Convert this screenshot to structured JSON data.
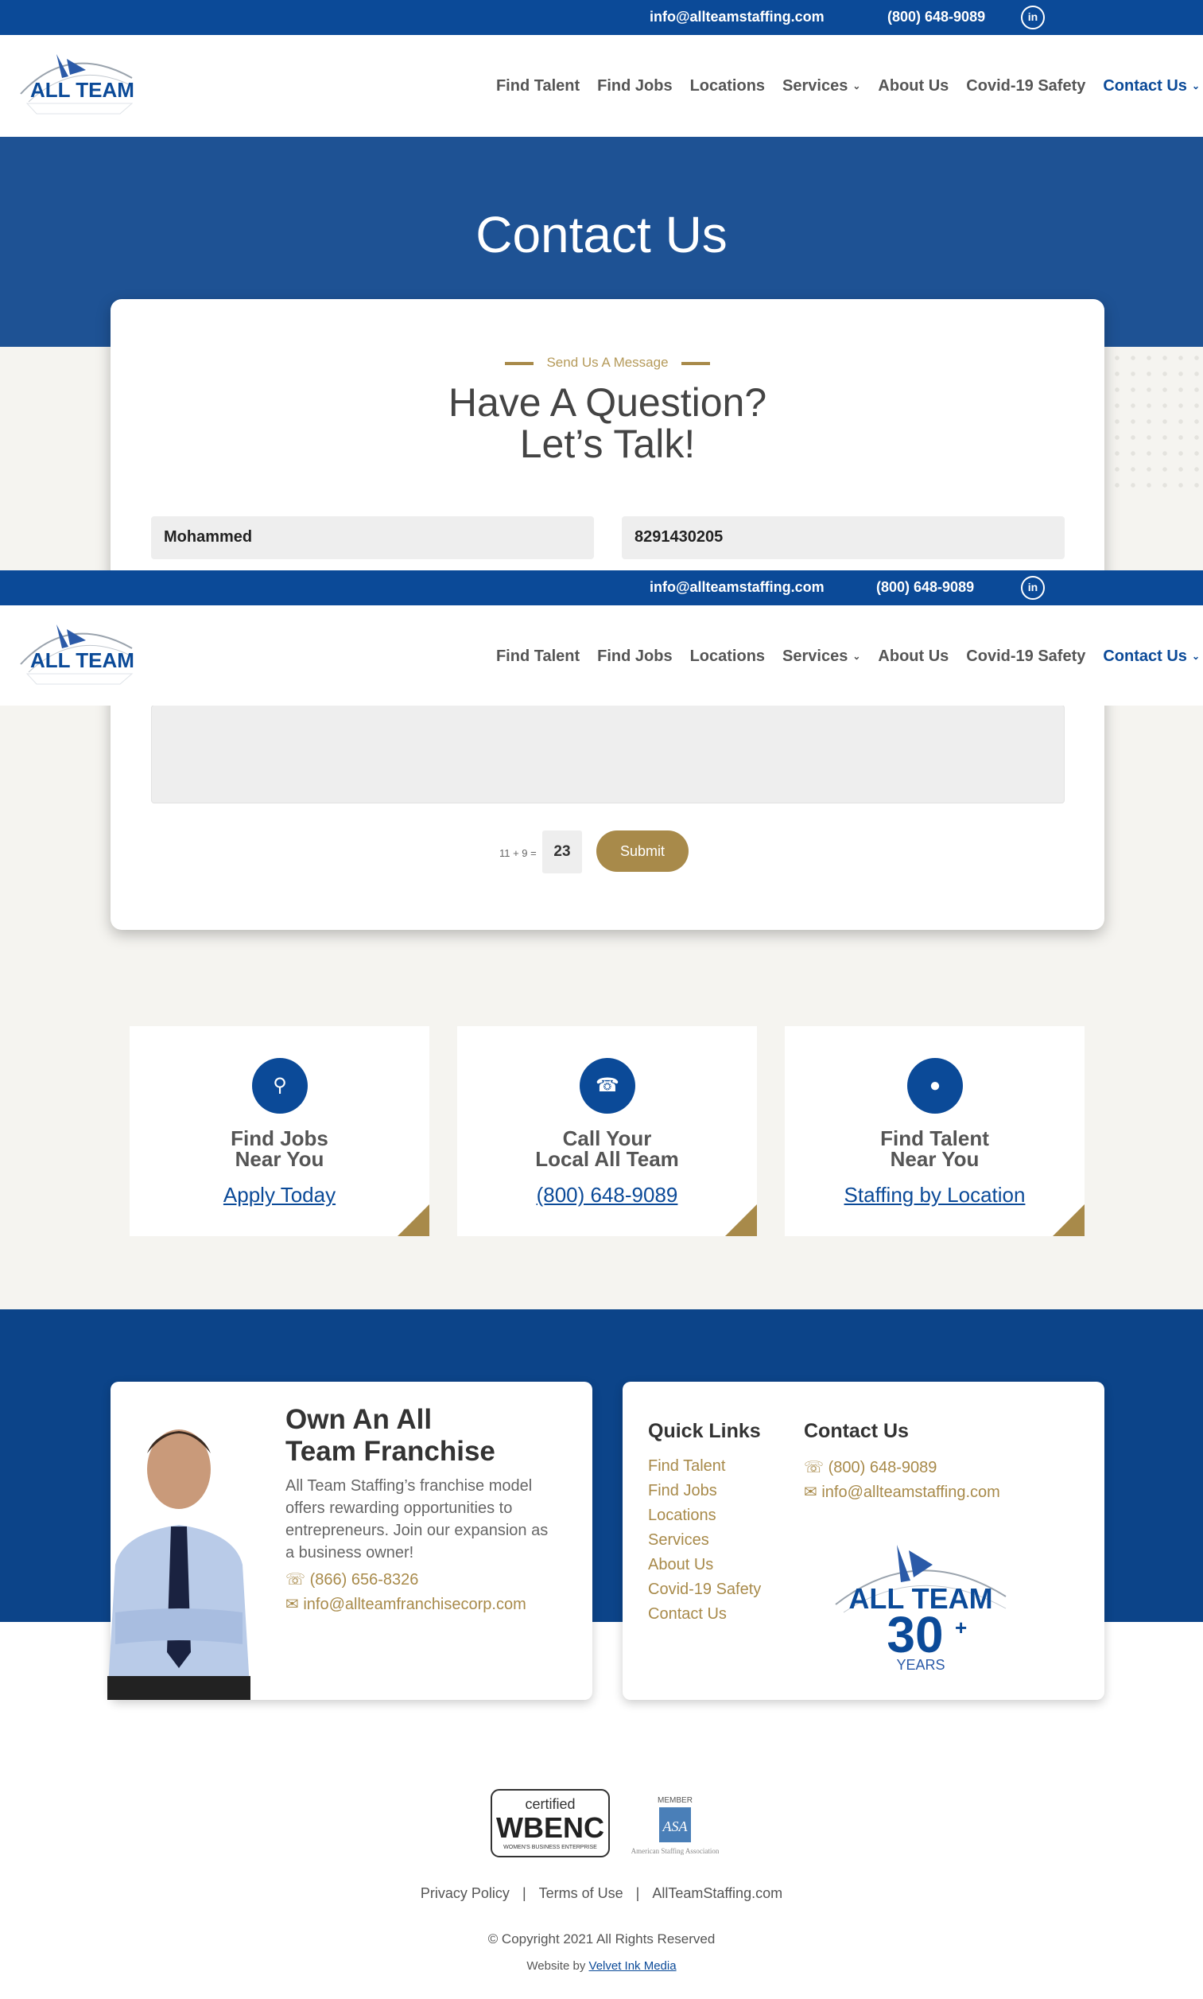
{
  "topbar": {
    "email": "info@allteamstaffing.com",
    "phone": "(800) 648-9089",
    "linkedin": "in"
  },
  "topbar2": {
    "phone": "(800) 648-9089"
  },
  "nav": {
    "items": [
      "Find Talent",
      "Find Jobs",
      "Locations",
      "Services",
      "About Us",
      "Covid-19 Safety",
      "Contact Us"
    ]
  },
  "logo": {
    "text": "ALL TEAM"
  },
  "hero": {
    "title": "Contact Us"
  },
  "form": {
    "eyebrow": "Send Us A Message",
    "heading_line1": "Have A Question?",
    "heading_line2": "Let’s Talk!",
    "name_value": "Mohammed",
    "phone_value": "8291430205",
    "captcha_label": "11 + 9 =",
    "captcha_value": "23",
    "submit_label": "Submit"
  },
  "cards": [
    {
      "title1": "Find Jobs",
      "title2": "Near You",
      "link": "Apply Today",
      "icon": "search-icon"
    },
    {
      "title1": "Call Your",
      "title2": "Local All Team",
      "link": "(800) 648-9089",
      "icon": "phone-icon"
    },
    {
      "title1": "Find Talent",
      "title2": "Near You",
      "link": "Staffing by Location",
      "icon": "person-icon"
    }
  ],
  "franchise": {
    "title1": "Own An All",
    "title2": "Team Franchise",
    "body": "All Team Staffing’s franchise model offers rewarding opportunities to entrepreneurs. Join our expansion as a business owner!",
    "phone": "(866) 656-8326",
    "email": "info@allteamfranchisecorp.com"
  },
  "quicklinks": {
    "title": "Quick Links",
    "items": [
      "Find Talent",
      "Find Jobs",
      "Locations",
      "Services",
      "About Us",
      "Covid-19 Safety",
      "Contact Us"
    ]
  },
  "contact": {
    "title": "Contact Us",
    "phone": "(800) 648-9089",
    "email": "info@allteamstaffing.com"
  },
  "badge": {
    "line1": "ALL TEAM",
    "number": "30",
    "plus": "+",
    "years": "YEARS"
  },
  "wbenc": {
    "top": "certified",
    "mid": "WBENC",
    "bot": "WOMEN'S BUSINESS ENTERPRISE"
  },
  "asa": {
    "member": "MEMBER",
    "mark": "ASA",
    "name": "American Staffing Association"
  },
  "legal": {
    "privacy": "Privacy Policy",
    "terms": "Terms of Use",
    "site": "AllTeamStaffing.com"
  },
  "copyright": "© Copyright 2021 All Rights Reserved",
  "made": {
    "prefix": "Website by",
    "link": "Velvet Ink Media"
  },
  "colors": {
    "primary": "#0b4a98",
    "hero": "#1e5294",
    "gold": "#a88a4a",
    "footer": "#0c4489"
  }
}
